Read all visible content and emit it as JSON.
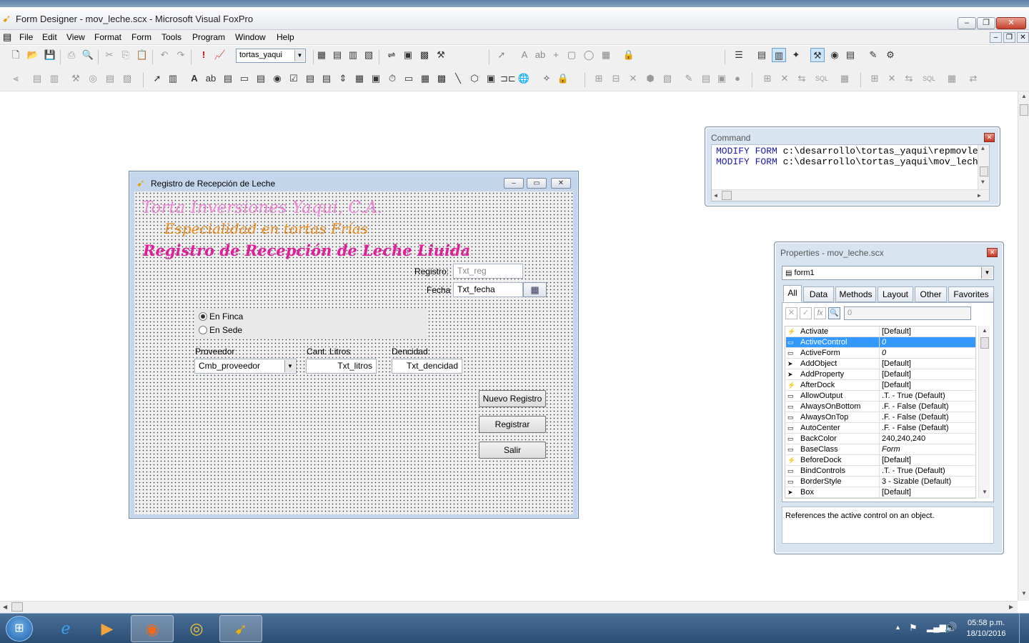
{
  "app": {
    "title": "Form Designer - mov_leche.scx - Microsoft Visual FoxPro"
  },
  "menu": [
    "File",
    "Edit",
    "View",
    "Format",
    "Form",
    "Tools",
    "Program",
    "Window",
    "Help"
  ],
  "toolbar": {
    "project_combo": "tortas_yaqui"
  },
  "form": {
    "title": "Registro de Recepción de Leche",
    "heading1": "Torta Inversiones Yaqui, C.A.",
    "heading2": "Especialidad en tortas Frías",
    "heading3": "Registro de Recepción de Leche Liuida",
    "registro_label": "Registro:",
    "registro_value": "Txt_reg",
    "fecha_label": "Fecha",
    "fecha_value": "Txt_fecha",
    "radio_finca": "En Finca",
    "radio_sede": "En Sede",
    "proveedor_label": "Proveedor",
    "proveedor_value": "Cmb_proveedor",
    "litros_label": "Cant. Litros",
    "litros_value": "Txt_litros",
    "densidad_label": "Dencidad:",
    "densidad_value": "Txt_dencidad",
    "btn_nuevo": "Nuevo Registro",
    "btn_registrar": "Registrar",
    "btn_salir": "Salir"
  },
  "command": {
    "title": "Command",
    "lines": [
      {
        "kw1": "MODIFY",
        "kw2": "FORM",
        "path": "c:\\desarrollo\\tortas_yaqui\\repmovle"
      },
      {
        "kw1": "MODIFY",
        "kw2": "FORM",
        "path": "c:\\desarrollo\\tortas_yaqui\\mov_lech"
      }
    ]
  },
  "properties": {
    "title": "Properties - mov_leche.scx",
    "object": "form1",
    "tabs": [
      "All",
      "Data",
      "Methods",
      "Layout",
      "Other",
      "Favorites"
    ],
    "value_box": "0",
    "rows": [
      {
        "name": "Activate",
        "value": "[Default]"
      },
      {
        "name": "ActiveControl",
        "value": "0"
      },
      {
        "name": "ActiveForm",
        "value": "0"
      },
      {
        "name": "AddObject",
        "value": "[Default]"
      },
      {
        "name": "AddProperty",
        "value": "[Default]"
      },
      {
        "name": "AfterDock",
        "value": "[Default]"
      },
      {
        "name": "AllowOutput",
        "value": ".T. - True (Default)"
      },
      {
        "name": "AlwaysOnBottom",
        "value": ".F. - False (Default)"
      },
      {
        "name": "AlwaysOnTop",
        "value": ".F. - False (Default)"
      },
      {
        "name": "AutoCenter",
        "value": ".F. - False (Default)"
      },
      {
        "name": "BackColor",
        "value": "240,240,240"
      },
      {
        "name": "BaseClass",
        "value": "Form"
      },
      {
        "name": "BeforeDock",
        "value": "[Default]"
      },
      {
        "name": "BindControls",
        "value": ".T. - True (Default)"
      },
      {
        "name": "BorderStyle",
        "value": "3 - Sizable (Default)"
      },
      {
        "name": "Box",
        "value": "[Default]"
      }
    ],
    "description": "References the active control on an object."
  },
  "taskbar": {
    "time": "05:58 p.m.",
    "date": "18/10/2016"
  },
  "colors": {
    "heading1": "#ee88d6",
    "heading2": "#e88a1c",
    "heading3": "#e0209a",
    "selection": "#3399ff"
  }
}
